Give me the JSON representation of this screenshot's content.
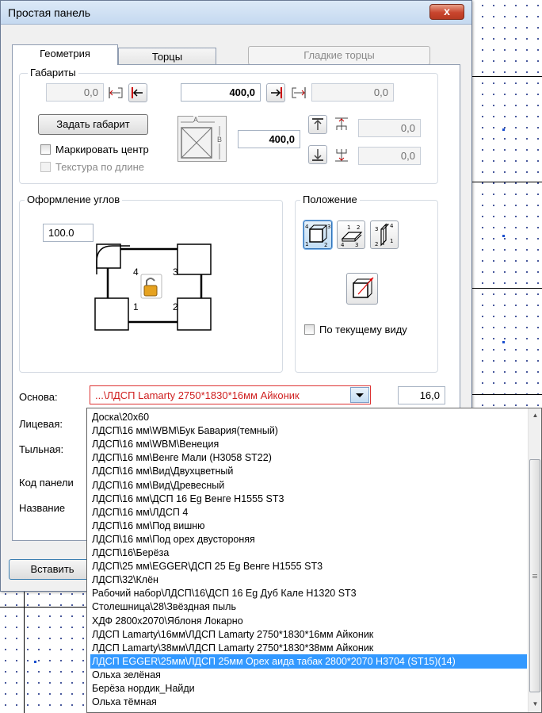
{
  "window": {
    "title": "Простая панель",
    "close_label": "x"
  },
  "tabs": [
    {
      "label": "Геометрия",
      "active": true
    },
    {
      "label": "Торцы",
      "active": false
    },
    {
      "label": "Гладкие торцы",
      "active": false,
      "disabled": true
    }
  ],
  "dimensions": {
    "group_label": "Габариты",
    "left_offset": "0,0",
    "width": "400,0",
    "right_offset": "0,0",
    "set_size_button": "Задать габарит",
    "height": "400,0",
    "top_offset": "0,0",
    "bottom_offset": "0,0",
    "mark_center_label": "Маркировать центр",
    "texture_along_label": "Текстура по длине",
    "sketch_a": "A",
    "sketch_b": "B"
  },
  "corners": {
    "group_label": "Оформление углов",
    "radius_value": "100.0",
    "corner_numbers": [
      "4",
      "3",
      "1",
      "2"
    ]
  },
  "position": {
    "group_label": "Положение",
    "by_current_view_label": "По текущему виду"
  },
  "fields": {
    "base_label": "Основа:",
    "base_value": "...\\ЛДСП Lamarty 2750*1830*16мм Айконик",
    "thickness": "16,0",
    "face_label": "Лицевая:",
    "back_label": "Тыльная:",
    "panel_code_label": "Код панели",
    "name_label": "Название"
  },
  "buttons": {
    "insert_label": "Вставить"
  },
  "dropdown": {
    "items": [
      "Доска\\20х60",
      "ЛДСП\\16 мм\\WBM\\Бук Бавария(темный)",
      "ЛДСП\\16 мм\\WBM\\Венеция",
      "ЛДСП\\16 мм\\Венге Мали (Н3058 ST22)",
      "ЛДСП\\16 мм\\Вид\\Двухцветный",
      "ЛДСП\\16 мм\\Вид\\Древесный",
      "ЛДСП\\16 мм\\ДСП 16 Eg Венге H1555 ST3",
      "ЛДСП\\16 мм\\ЛДСП 4",
      "ЛДСП\\16 мм\\Под вишню",
      "ЛДСП\\16 мм\\Под орех двустороняя",
      "ЛДСП\\16\\Берёза",
      "ЛДСП\\25 мм\\EGGER\\ДСП 25 Eg Венге H1555 ST3",
      "ЛДСП\\32\\Клён",
      "Рабочий набор\\ЛДСП\\16\\ДСП 16 Eg Дуб Кале H1320 ST3",
      "Столешница\\28\\Звёздная пыль",
      "ХДФ 2800х2070\\Яблоня Локарно",
      "ЛДСП Lamarty\\16мм\\ЛДСП Lamarty 2750*1830*16мм Айконик",
      "ЛДСП Lamarty\\38мм\\ЛДСП Lamarty 2750*1830*38мм Айконик",
      "ЛДСП EGGER\\25мм\\ЛДСП 25мм Орех аида табак 2800*2070 Н3704 (ST15)(14)",
      "Ольха зелёная",
      "Берёза нордик_Найди",
      "Ольха тёмная"
    ],
    "selected_index": 18
  }
}
